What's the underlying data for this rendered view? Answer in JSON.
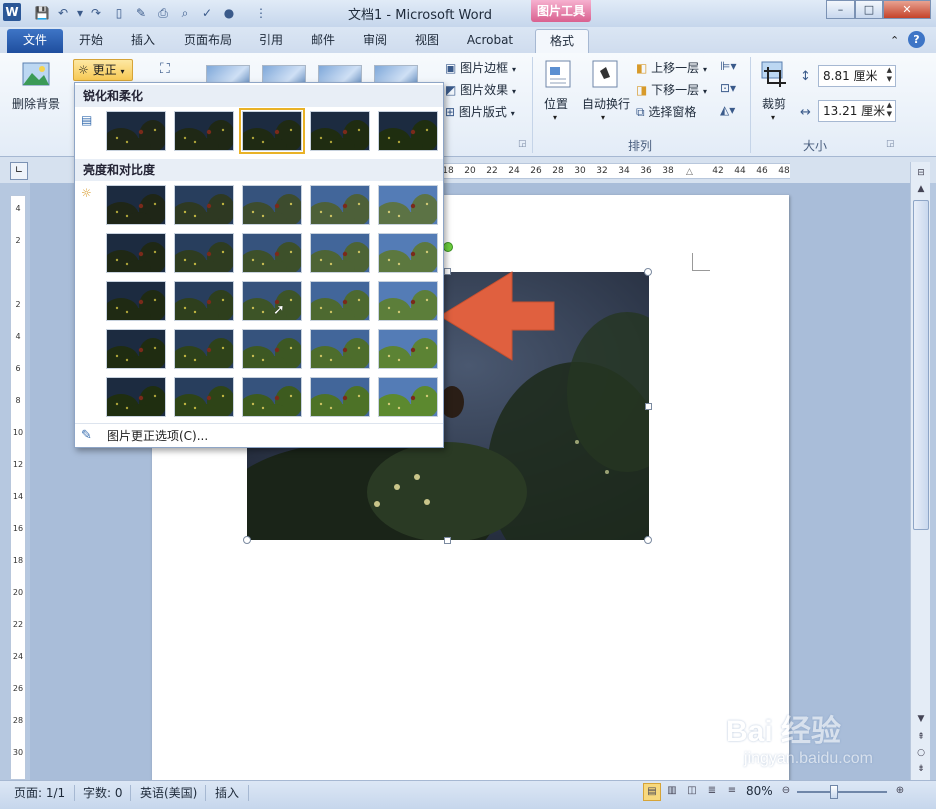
{
  "window": {
    "title": "文档1 - Microsoft Word",
    "app_icon_letter": "W",
    "contextual_tab_group": "图片工具",
    "controls": {
      "minimize": "–",
      "maximize": "□",
      "close": "✕"
    }
  },
  "tabs": [
    {
      "label": "文件"
    },
    {
      "label": "开始"
    },
    {
      "label": "插入"
    },
    {
      "label": "页面布局"
    },
    {
      "label": "引用"
    },
    {
      "label": "邮件"
    },
    {
      "label": "审阅"
    },
    {
      "label": "视图"
    },
    {
      "label": "Acrobat"
    },
    {
      "label": "格式"
    }
  ],
  "ribbon": {
    "remove_background": "删除背景",
    "corrections": "更正",
    "picture_border": "图片边框",
    "picture_effects": "图片效果",
    "picture_layout": "图片版式",
    "position": "位置",
    "wrap_text": "自动换行",
    "bring_forward": "上移一层",
    "send_backward": "下移一层",
    "selection_pane": "选择窗格",
    "arrange_group": "排列",
    "crop": "裁剪",
    "height": "8.81 厘米",
    "width": "13.21 厘米",
    "size_group": "大小"
  },
  "gallery": {
    "sharpen_heading": "锐化和柔化",
    "brightness_heading": "亮度和对比度",
    "options_link": "图片更正选项(C)..."
  },
  "ruler": {
    "h_ticks": [
      "18",
      "20",
      "22",
      "24",
      "26",
      "28",
      "30",
      "32",
      "34",
      "36",
      "38",
      "42",
      "44",
      "46",
      "48"
    ],
    "v_ticks": [
      "4",
      "2",
      "2",
      "4",
      "6",
      "8",
      "10",
      "12",
      "14",
      "16",
      "18",
      "20",
      "22",
      "24",
      "26",
      "28",
      "30"
    ]
  },
  "status": {
    "page": "页面: 1/1",
    "words": "字数: 0",
    "language": "英语(美国)",
    "mode": "插入",
    "zoom": "80%"
  },
  "watermark": {
    "brand": "Bai 经验",
    "url": "jingyan.baidu.com"
  },
  "colors": {
    "accent": "#2b5797",
    "contextual": "#d9608f",
    "selected": "#e9b227",
    "arrow": "#e0603f"
  }
}
